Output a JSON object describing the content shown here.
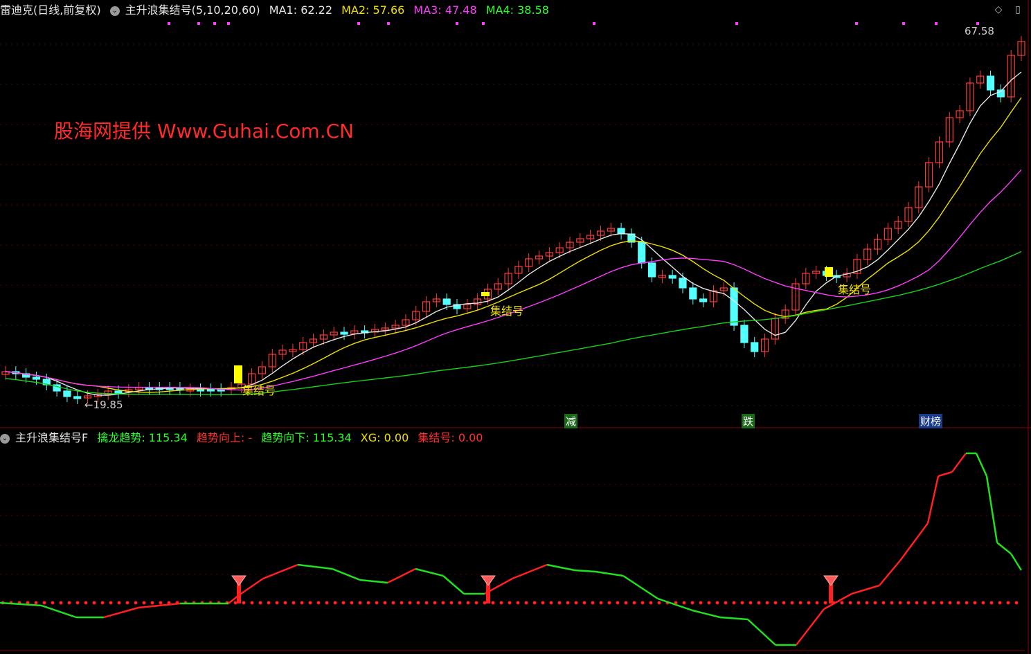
{
  "main_header": {
    "stock_title": "雷迪克(日线,前复权)",
    "indicator_name": "主升浪集结号(5,10,20,60)",
    "ma1": "MA1: 62.22",
    "ma2": "MA2: 57.66",
    "ma3": "MA3: 47.48",
    "ma4": "MA4: 38.58"
  },
  "sub_header": {
    "indicator_name": "主升浪集结号F",
    "qinlong": "擒龙趋势: 115.34",
    "up": "趋势向上: -",
    "down": "趋势向下: 115.34",
    "xg": "XG: 0.00",
    "jijiehao": "集结号: 0.00"
  },
  "watermark": "股海网提供 Www.Guhai.Com.CN",
  "price_labels": {
    "high": "67.58",
    "low": "←19.85"
  },
  "signal_label": "集结号",
  "event_tags": [
    "减",
    "跌",
    "财榜"
  ],
  "colors": {
    "up_candle": "#ff3b3b",
    "down_candle": "#54ffff",
    "ma1": "#e6e6e6",
    "ma2": "#f0e000",
    "ma3": "#ff3cff",
    "ma4": "#18d018",
    "indicator_up": "#ff2020",
    "indicator_down": "#20e020"
  },
  "icons": [
    "collapse-circle-icon",
    "diamond-icon",
    "window-icon"
  ]
}
